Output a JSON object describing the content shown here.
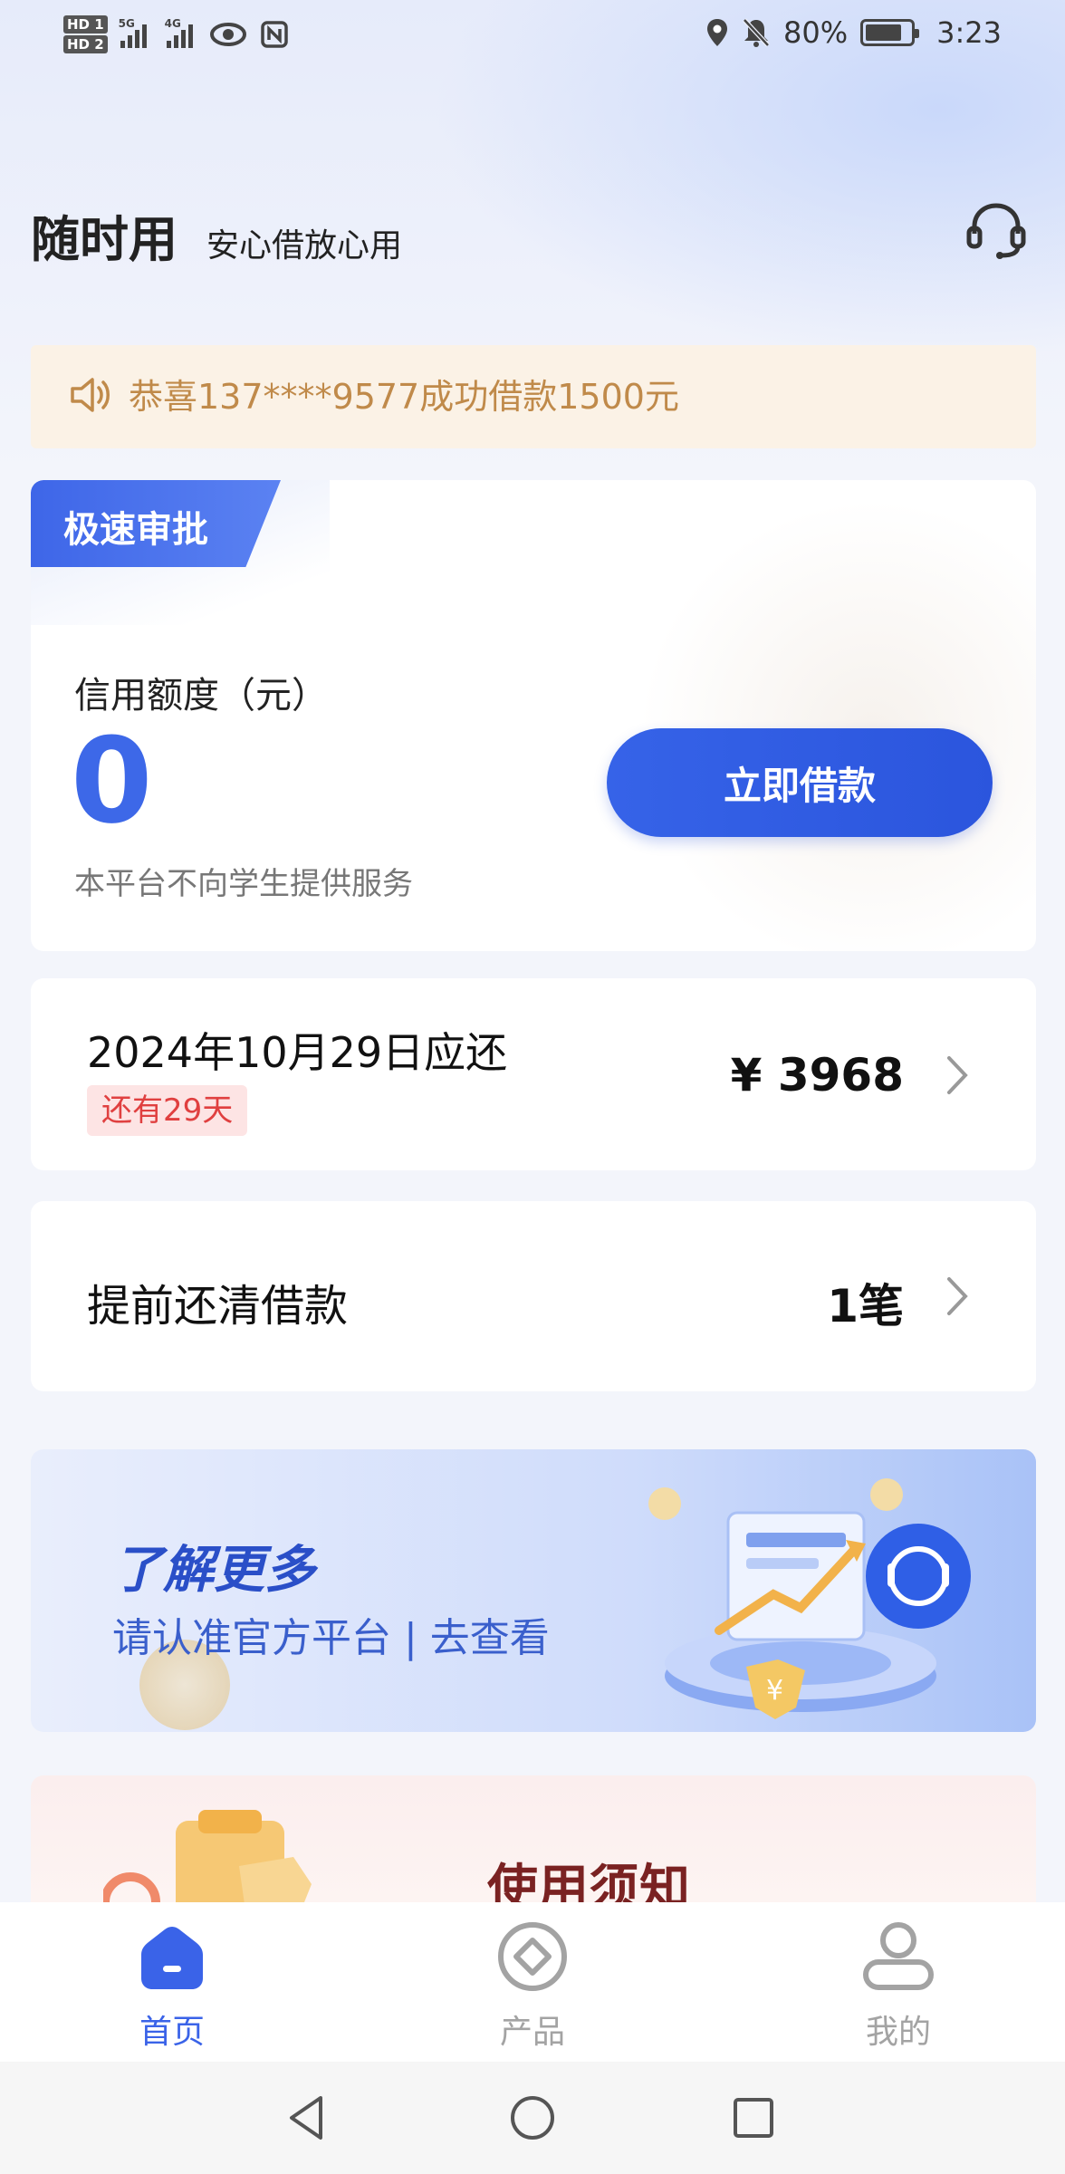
{
  "status_bar": {
    "hd_top": "HD 1",
    "hd_bottom": "HD 2",
    "gen_1": "5G",
    "gen_2": "4G",
    "battery_pct": "80%",
    "battery_level": 0.8,
    "time": "3:23"
  },
  "header": {
    "title": "随时用",
    "slogan": "安心借放心用"
  },
  "notice": {
    "text": "恭喜137****9577成功借款1500元"
  },
  "credit": {
    "badge": "极速审批",
    "label": "信用额度（元）",
    "value": "0",
    "note": "本平台不向学生提供服务",
    "borrow_button": "立即借款"
  },
  "repayment": {
    "title": "2024年10月29日应还",
    "days_left": "还有29天",
    "amount": "¥ 3968"
  },
  "prepay": {
    "title": "提前还清借款",
    "count": "1笔"
  },
  "banner": {
    "title": "了解更多",
    "subtitle": "请认准官方平台 | 去查看"
  },
  "rules": {
    "title": "使用须知"
  },
  "tabs": [
    {
      "label": "首页",
      "icon": "home-icon",
      "active": true
    },
    {
      "label": "产品",
      "icon": "product-icon",
      "active": false
    },
    {
      "label": "我的",
      "icon": "profile-icon",
      "active": false
    }
  ],
  "colors": {
    "accent": "#3a63e8",
    "notice_text": "#c08a4a",
    "tag_red": "#e04040"
  }
}
